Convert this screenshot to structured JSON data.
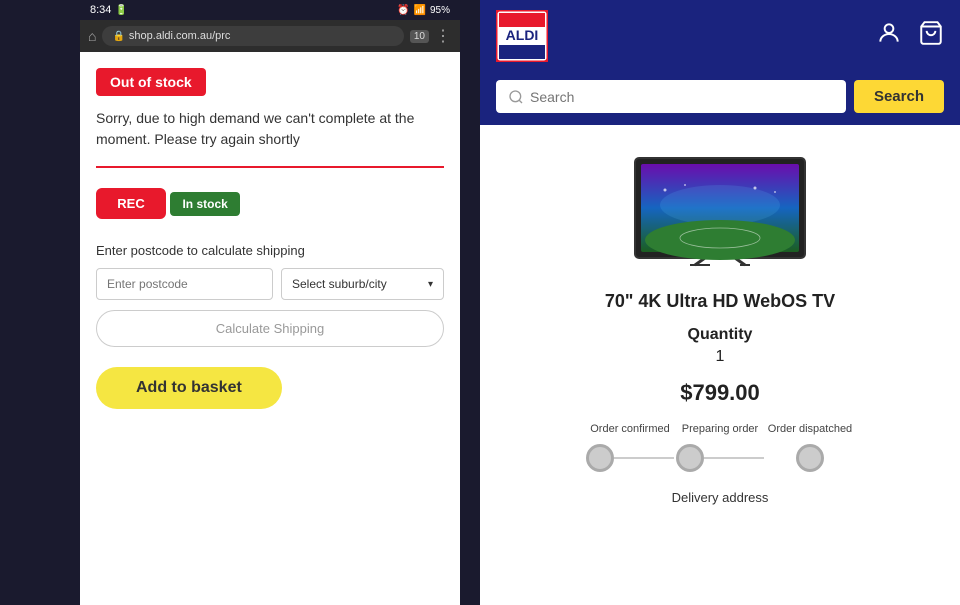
{
  "left": {
    "status_bar": {
      "time": "8:34",
      "battery": "95%"
    },
    "browser": {
      "url": "shop.aldi.com.au/prc",
      "tab_count": "10"
    },
    "out_of_stock": {
      "badge": "Out of stock",
      "message": "Sorry, due to high demand we can't complete at the moment. Please try again shortly"
    },
    "rec_label": "REC",
    "in_stock_label": "In stock",
    "shipping": {
      "label": "Enter postcode to calculate shipping",
      "postcode_placeholder": "Enter postcode",
      "suburb_placeholder": "Select suburb/city",
      "calculate_label": "Calculate Shipping"
    },
    "add_to_basket": "Add to basket"
  },
  "right": {
    "header": {
      "logo_text": "ALDI",
      "logo_colors": {
        "border": "#e8192c",
        "bg": "#fff",
        "text_aldi": "#1a237e",
        "stripe_blue": "#1a237e",
        "stripe_red": "#e8192c",
        "stripe_yellow": "#fdd835"
      }
    },
    "search": {
      "placeholder": "Search",
      "button_label": "Search"
    },
    "product": {
      "title": "70\" 4K Ultra HD WebOS TV",
      "quantity_label": "Quantity",
      "quantity_value": "1",
      "price": "$799.00",
      "steps": [
        {
          "label": "Order confirmed"
        },
        {
          "label": "Preparing order"
        },
        {
          "label": "Order dispatched"
        }
      ],
      "delivery_label": "Delivery address"
    }
  }
}
